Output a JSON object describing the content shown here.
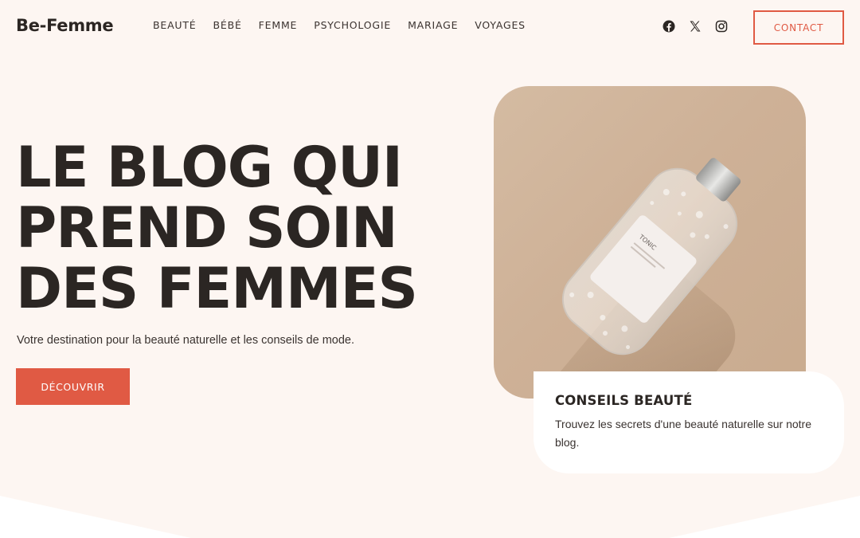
{
  "header": {
    "logo": "Be-Femme",
    "nav": [
      "BEAUTÉ",
      "BÉBÉ",
      "FEMME",
      "PSYCHOLOGIE",
      "MARIAGE",
      "VOYAGES"
    ],
    "social_icons": [
      "facebook-icon",
      "x-twitter-icon",
      "instagram-icon"
    ],
    "contact_label": "CONTACT"
  },
  "hero": {
    "title_lines": [
      "LE BLOG QUI",
      "PREND SOIN",
      "DES FEMMES"
    ],
    "subtitle": "Votre destination pour la beauté naturelle et les conseils de mode.",
    "cta_label": "DÉCOUVRIR"
  },
  "feature_card": {
    "title": "CONSEILS BEAUTÉ",
    "text": "Trouvez les secrets d'une beauté naturelle sur notre blog."
  },
  "product_label": {
    "brand": "TONIC"
  },
  "colors": {
    "background": "#fdf6f2",
    "accent": "#e05a44",
    "text": "#2b2623",
    "photo_bg": "#cfb398"
  }
}
